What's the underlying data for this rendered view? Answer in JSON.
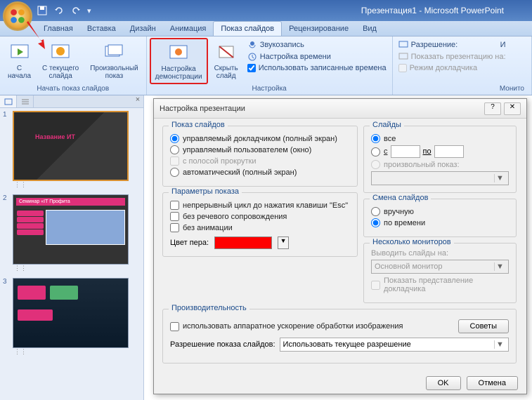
{
  "app": {
    "title": "Презентация1 - Microsoft PowerPoint"
  },
  "tabs": {
    "home": "Главная",
    "insert": "Вставка",
    "design": "Дизайн",
    "animation": "Анимация",
    "slideshow": "Показ слайдов",
    "review": "Рецензирование",
    "view": "Вид"
  },
  "ribbon": {
    "from_start": "С\nначала",
    "from_current": "С текущего\nслайда",
    "custom": "Произвольный\nпоказ",
    "setup": "Настройка\nдемонстрации",
    "hide": "Скрыть\nслайд",
    "group_start": "Начать показ слайдов",
    "group_setup": "Настройка",
    "group_monitor": "Монито",
    "record": "Звукозапись",
    "rehearse": "Настройка времени",
    "use_timings": "Использовать записанные времена",
    "resolution": "Разрешение:",
    "show_on": "Показать презентацию на:",
    "presenter": "Режим докладчика",
    "i": "И"
  },
  "thumbs": {
    "n1": "1",
    "n2": "2",
    "n3": "3",
    "seminar": "Семинар «IT Профита"
  },
  "dialog": {
    "title": "Настройка презентации",
    "show_type": "Показ слайдов",
    "type_speaker": "управляемый докладчиком (полный экран)",
    "type_browsed": "управляемый пользователем (окно)",
    "scrollbar": "с полосой прокрутки",
    "type_kiosk": "автоматический (полный экран)",
    "slides": "Слайды",
    "slides_all": "все",
    "slides_from": "с",
    "slides_to": "по",
    "custom_show": "произвольный показ:",
    "options": "Параметры показа",
    "loop": "непрерывный цикл до нажатия клавиши \"Esc\"",
    "no_narration": "без речевого сопровождения",
    "no_animation": "без анимации",
    "pen": "Цвет пера:",
    "advance": "Смена слайдов",
    "adv_manual": "вручную",
    "adv_timings": "по времени",
    "monitors": "Несколько мониторов",
    "display_on": "Выводить слайды на:",
    "primary": "Основной монитор",
    "presenter_view": "Показать представление докладчика",
    "performance": "Производительность",
    "hw_accel": "использовать аппаратное ускорение обработки изображения",
    "tips": "Советы",
    "res_label": "Разрешение показа слайдов:",
    "res_value": "Использовать текущее разрешение",
    "ok": "OK",
    "cancel": "Отмена",
    "help": "?",
    "close": "✕"
  }
}
